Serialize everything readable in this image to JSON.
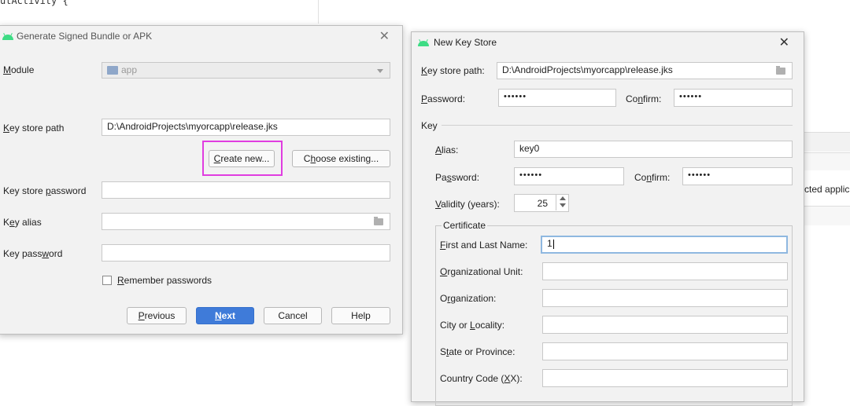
{
  "background": {
    "editor_text": "utActivity {",
    "right_table_text": "cted applic"
  },
  "generate_dialog": {
    "title": "Generate Signed Bundle or APK",
    "module_label_u": "M",
    "module_label_rest": "odule",
    "module_value": "app",
    "key_store_path_label_u": "K",
    "key_store_path_label_rest": "ey store path",
    "key_store_path_value": "D:\\AndroidProjects\\myorcapp\\release.jks",
    "create_new_u": "C",
    "create_new_rest": "reate new...",
    "choose_existing_pre": "C",
    "choose_existing_u": "h",
    "choose_existing_rest": "oose existing...",
    "key_store_password_pre": "Key store ",
    "key_store_password_u": "p",
    "key_store_password_rest": "assword",
    "key_alias_pre": "K",
    "key_alias_u": "e",
    "key_alias_rest": "y alias",
    "key_password_pre": "Key pass",
    "key_password_u": "w",
    "key_password_rest": "ord",
    "remember_u": "R",
    "remember_rest": "emember passwords",
    "previous_u": "P",
    "previous_rest": "revious",
    "next_u": "N",
    "next_rest": "ext",
    "cancel": "Cancel",
    "help": "Help"
  },
  "key_store_dialog": {
    "title": "New Key Store",
    "path_u": "K",
    "path_rest": "ey store path:",
    "path_value": "D:\\AndroidProjects\\myorcapp\\release.jks",
    "password_u": "P",
    "password_rest": "assword:",
    "password_value": "••••••",
    "confirm_pre": "Co",
    "confirm_u": "n",
    "confirm_rest": "firm:",
    "confirm_value": "••••••",
    "key_section": "Key",
    "alias_u": "A",
    "alias_rest": "lias:",
    "alias_value": "key0",
    "key_password_pre": "Pa",
    "key_password_u": "s",
    "key_password_rest": "sword:",
    "key_password_value": "••••••",
    "key_confirm_pre": "Co",
    "key_confirm_u": "n",
    "key_confirm_rest": "firm:",
    "key_confirm_value": "••••••",
    "validity_u": "V",
    "validity_rest": "alidity (years):",
    "validity_value": "25",
    "certificate_legend": "Certificate",
    "first_last_u": "F",
    "first_last_rest": "irst and Last Name:",
    "first_last_value": "1",
    "org_unit_u": "O",
    "org_unit_rest": "rganizational Unit:",
    "org_pre": "O",
    "org_u": "r",
    "org_rest": "ganization:",
    "city_pre": "City or ",
    "city_u": "L",
    "city_rest": "ocality:",
    "state_pre": "S",
    "state_u": "t",
    "state_rest": "ate or Province:",
    "country_pre": "Country Code (",
    "country_u": "X",
    "country_rest": "X):"
  }
}
